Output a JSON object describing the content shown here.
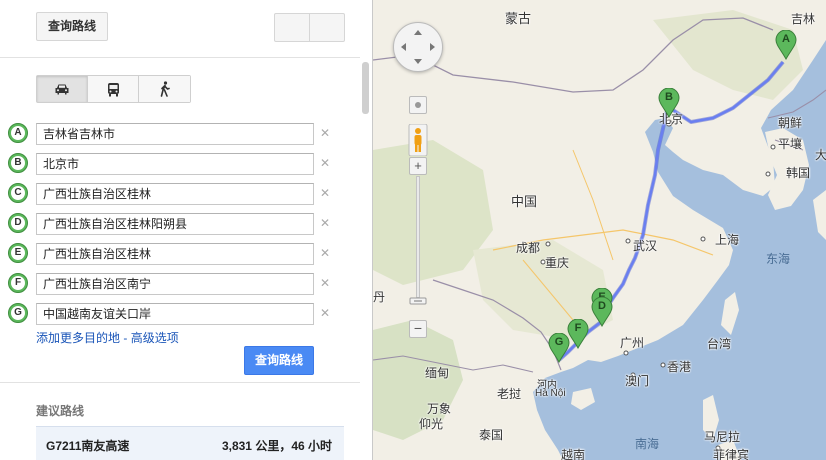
{
  "toolbar": {
    "query_button_label": "查询路线"
  },
  "travel_modes": [
    "car",
    "transit",
    "walk"
  ],
  "waypoints": [
    {
      "letter": "A",
      "value": "吉林省吉林市"
    },
    {
      "letter": "B",
      "value": "北京市"
    },
    {
      "letter": "C",
      "value": "广西壮族自治区桂林"
    },
    {
      "letter": "D",
      "value": "广西壮族自治区桂林阳朔县"
    },
    {
      "letter": "E",
      "value": "广西壮族自治区桂林"
    },
    {
      "letter": "F",
      "value": "广西壮族自治区南宁"
    },
    {
      "letter": "G",
      "value": "中国越南友谊关口岸"
    }
  ],
  "links": {
    "add_destination": "添加更多目的地",
    "separator": " - ",
    "advanced": "高级选项"
  },
  "search_button_label": "查询路线",
  "suggested": {
    "title": "建议路线",
    "route_name": "G7211南友高速",
    "route_info": "3,831 公里，46 小时"
  },
  "map": {
    "labels": {
      "mongolia": "蒙古",
      "beijing": "北京",
      "north_korea": "朝鲜",
      "pyongyang": "平壤",
      "jilin": "吉林",
      "south_korea": "韩国",
      "china": "中国",
      "chengdu": "成都",
      "chongqing": "重庆",
      "wuhan": "武汉",
      "shanghai": "上海",
      "east_sea": "东海",
      "guangzhou": "广州",
      "hongkong": "香港",
      "macau": "澳门",
      "taiwan": "台湾",
      "myanmar": "缅甸",
      "laos": "老挝",
      "hanoi_cn": "河内",
      "hanoi": "Hà Nội",
      "vientiane": "万象",
      "yangon": "仰光",
      "thailand": "泰国",
      "south_sea": "南海",
      "manila": "马尼拉",
      "philippines": "菲律宾",
      "cut_left": "丹",
      "cut_right": "大",
      "cut_bottom": "越南"
    }
  },
  "colors": {
    "route": "#5a6fe0",
    "marker": "#5cb85c",
    "button_blue": "#4a8af4",
    "link": "#1a55b8"
  },
  "icons": [
    "car-icon",
    "bus-icon",
    "walk-icon",
    "close-icon",
    "pan-control-icon",
    "pegman-icon",
    "zoom-in-icon",
    "zoom-out-icon"
  ]
}
